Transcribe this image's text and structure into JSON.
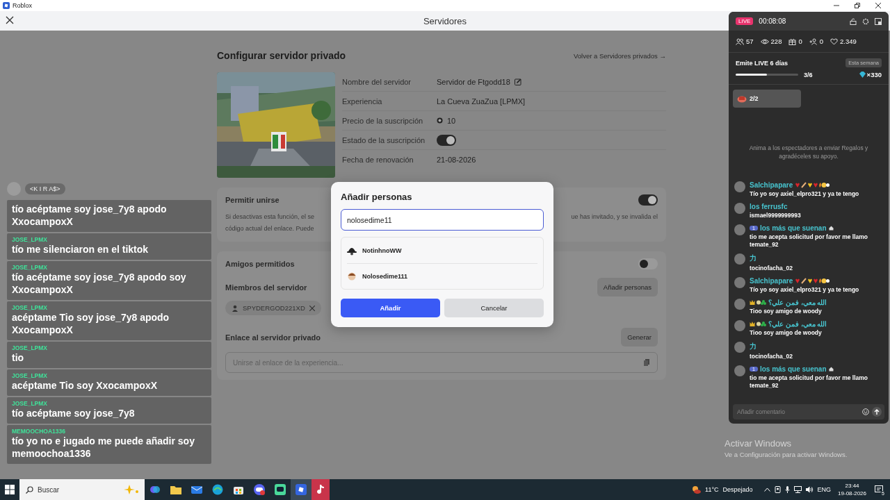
{
  "title_bar": {
    "title": "Roblox"
  },
  "header": {
    "title": "Servidores"
  },
  "page": {
    "title": "Configurar servidor privado",
    "back_link": "Volver a Servidores privados →",
    "details": [
      {
        "label": "Nombre del servidor",
        "value": "Servidor de Ftgodd18",
        "kind": "editable"
      },
      {
        "label": "Experiencia",
        "value": "La Cueva ZuaZua [LPMX]",
        "kind": "text"
      },
      {
        "label": "Precio de la suscripción",
        "value": "10",
        "kind": "price"
      },
      {
        "label": "Estado de la suscripción",
        "kind": "toggle",
        "on": true
      },
      {
        "label": "Fecha de renovación",
        "value": "21-08-2026",
        "kind": "text"
      }
    ],
    "allow_join": {
      "label": "Permitir unirse",
      "on": true,
      "description_left": [
        "Si desactivas esta función, el se",
        "código actual del enlace. Puede"
      ],
      "description_right": "ue has invitado, y se invalida el"
    },
    "friends_allowed": {
      "label": "Amigos permitidos",
      "on": false
    },
    "members": {
      "label": "Miembros del servidor",
      "button": "Añadir personas",
      "chips": [
        "SPYDERGOD221XD"
      ]
    },
    "link": {
      "label": "Enlace al servidor privado",
      "button": "Generar",
      "placeholder": "Unirse al enlace de la experiencia..."
    }
  },
  "modal": {
    "title": "Añadir personas",
    "value": "nolosedime11",
    "results": [
      {
        "name": "NotinhnoWW"
      },
      {
        "name": "Nolosedime111"
      }
    ],
    "buttons": [
      {
        "label": "Añadir",
        "kind": "primary"
      },
      {
        "label": "Cancelar",
        "kind": "secondary"
      }
    ]
  },
  "overlay_chat": {
    "tag": "<K I R A$>",
    "messages": [
      {
        "text": "tío acéptame soy jose_7y8 apodo XxocampoxX"
      },
      {
        "user": "JOSE_LPMX",
        "text": "tío me silenciaron en el tiktok"
      },
      {
        "user": "JOSE_LPMX",
        "text": "tío acéptame soy jose_7y8 apodo soy XxocampoxX"
      },
      {
        "user": "JOSE_LPMX",
        "text": "acéptame Tio soy jose_7y8 apodo XxocampoxX"
      },
      {
        "user": "JOSE_LPMX",
        "text": "tio"
      },
      {
        "user": "JOSE_LPMX",
        "text": "acéptame Tio soy XxocampoxX"
      },
      {
        "user": "JOSE_LPMX",
        "text": "tío acéptame soy jose_7y8"
      },
      {
        "user": "MEMOOCHOA1336",
        "text": "tío yo no e jugado me puede añadir soy memoochoa1336"
      }
    ]
  },
  "live_panel": {
    "badge": "LIVE",
    "timer": "00:08:08",
    "stats": [
      {
        "kind": "viewers",
        "value": "57"
      },
      {
        "kind": "views",
        "value": "228"
      },
      {
        "kind": "gifts",
        "value": "0"
      },
      {
        "kind": "follows",
        "value": "0"
      },
      {
        "kind": "likes",
        "value": "2.349"
      }
    ],
    "goal": {
      "title": "Emite LIVE 6 días",
      "tag": "Esta semana",
      "level": 0.5,
      "progress": "3/6",
      "reward": "×330"
    },
    "gift_card": {
      "count": "2/2"
    },
    "hint": "Anima a los espectadores a enviar Regalos y agradéceles su apoyo.",
    "comments": [
      {
        "kind": "emoji",
        "user": "Salchipapare",
        "text": "Tío yo soy axiel_elpro321 y ya te tengo"
      },
      {
        "kind": "plain",
        "user": "los ferrusfc",
        "text": "ismael9999999993"
      },
      {
        "kind": "ranked",
        "level": "1",
        "user": "los más que suenan",
        "text": "tio me acepta solicitud por favor me llamo temate_92"
      },
      {
        "kind": "plain",
        "user": "力",
        "text": "tocinofacha_02"
      },
      {
        "kind": "emoji",
        "user": "Salchipapare",
        "text": "Tío yo soy axiel_elpro321 y ya te tengo"
      },
      {
        "kind": "crowned",
        "user": "الله معي، فمن علي؟",
        "text": "Tioo soy amigo de woody"
      },
      {
        "kind": "crowned",
        "user": "الله معي، فمن علي؟",
        "text": "Tioo soy amigo de woody"
      },
      {
        "kind": "plain",
        "user": "力",
        "text": "tocinofacha_02"
      },
      {
        "kind": "ranked",
        "level": "1",
        "user": "los más que suenan",
        "text": "tio me acepta solicitud por favor me llamo temate_92"
      }
    ],
    "input": {
      "placeholder": "Añadir comentario"
    }
  },
  "activation_notice": {
    "title": "Activar Windows",
    "text": "Ve a Configuración para activar Windows."
  },
  "taskbar": {
    "search_placeholder": "Buscar",
    "temperature": "11°C",
    "weather": "Despejado",
    "language": "ENG",
    "time": "23:44",
    "date": "19-08-2026",
    "notifications": "5"
  }
}
